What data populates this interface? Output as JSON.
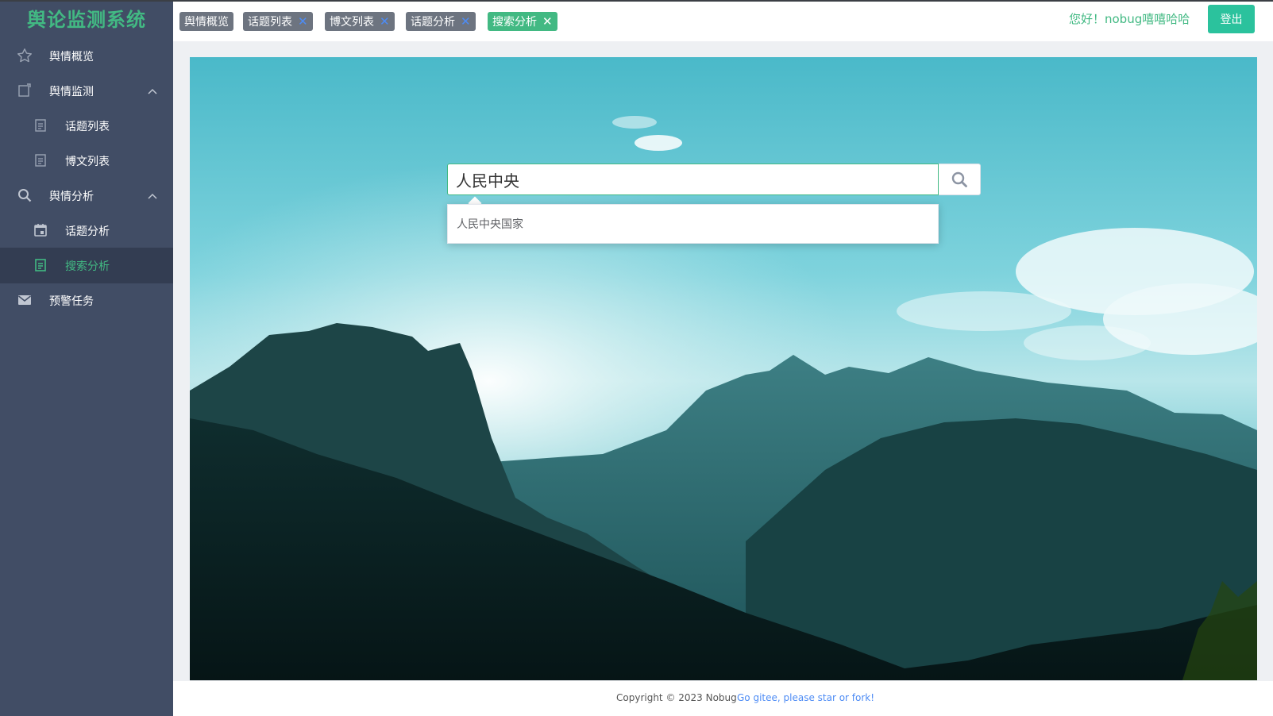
{
  "app": {
    "title": "舆论监测系统"
  },
  "sidebar": {
    "items": [
      {
        "label": "舆情概览",
        "icon": "star-icon"
      },
      {
        "label": "舆情监测",
        "icon": "monitor-icon",
        "expanded": true
      },
      {
        "label": "话题列表",
        "icon": "document-icon"
      },
      {
        "label": "博文列表",
        "icon": "document-icon"
      },
      {
        "label": "舆情分析",
        "icon": "search-icon",
        "expanded": true
      },
      {
        "label": "话题分析",
        "icon": "calendar-icon"
      },
      {
        "label": "搜索分析",
        "icon": "document-icon",
        "active": true
      },
      {
        "label": "预警任务",
        "icon": "mail-icon"
      }
    ]
  },
  "tabs": [
    {
      "label": "舆情概览",
      "closable": false
    },
    {
      "label": "话题列表",
      "closable": true,
      "close_glyph": "✕"
    },
    {
      "label": "博文列表",
      "closable": true,
      "close_glyph": "✕"
    },
    {
      "label": "话题分析",
      "closable": true,
      "close_glyph": "✕"
    },
    {
      "label": "搜索分析",
      "closable": true,
      "close_glyph": "✕",
      "active": true
    }
  ],
  "header": {
    "greeting": "您好！nobug嘻嘻哈哈",
    "logout_label": "登出"
  },
  "search": {
    "value": "人民中央",
    "suggestions": [
      "人民中央国家"
    ]
  },
  "footer": {
    "copyright": "Copyright © 2023 Nobug",
    "link_text": "Go gitee, please star or fork!"
  },
  "colors": {
    "sidebar_bg": "#414d65",
    "sidebar_active_bg": "#333d52",
    "accent": "#42b983",
    "logout_button": "#2bc29d",
    "tag_bg": "#6d7480",
    "link": "#4e8cf5"
  }
}
